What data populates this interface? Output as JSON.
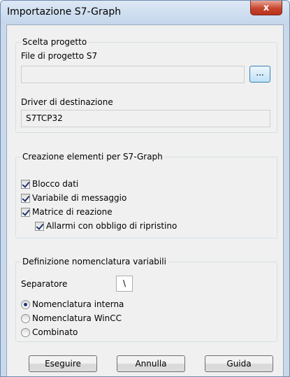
{
  "window": {
    "title": "Importazione S7-Graph",
    "close_label": "x"
  },
  "project": {
    "legend": "Scelta progetto",
    "file_label": "File di progetto S7",
    "file_value": "",
    "browse_label": "...",
    "driver_label": "Driver di destinazione",
    "driver_value": "S7TCP32"
  },
  "elements": {
    "legend": "Creazione elementi per S7-Graph",
    "items": [
      {
        "label": "Blocco dati",
        "checked": true
      },
      {
        "label": "Variabile di messaggio",
        "checked": true
      },
      {
        "label": "Matrice di reazione",
        "checked": true
      },
      {
        "label": "Allarmi con obbligo di ripristino",
        "checked": true
      }
    ]
  },
  "naming": {
    "legend": "Definizione nomenclatura variabili",
    "separator_label": "Separatore",
    "separator_value": "\\",
    "options": [
      {
        "label": "Nomenclatura interna",
        "selected": true
      },
      {
        "label": "Nomenclatura WinCC",
        "selected": false
      },
      {
        "label": "Combinato",
        "selected": false
      }
    ]
  },
  "buttons": {
    "execute": "Eseguire",
    "cancel": "Annulla",
    "help": "Guida"
  }
}
